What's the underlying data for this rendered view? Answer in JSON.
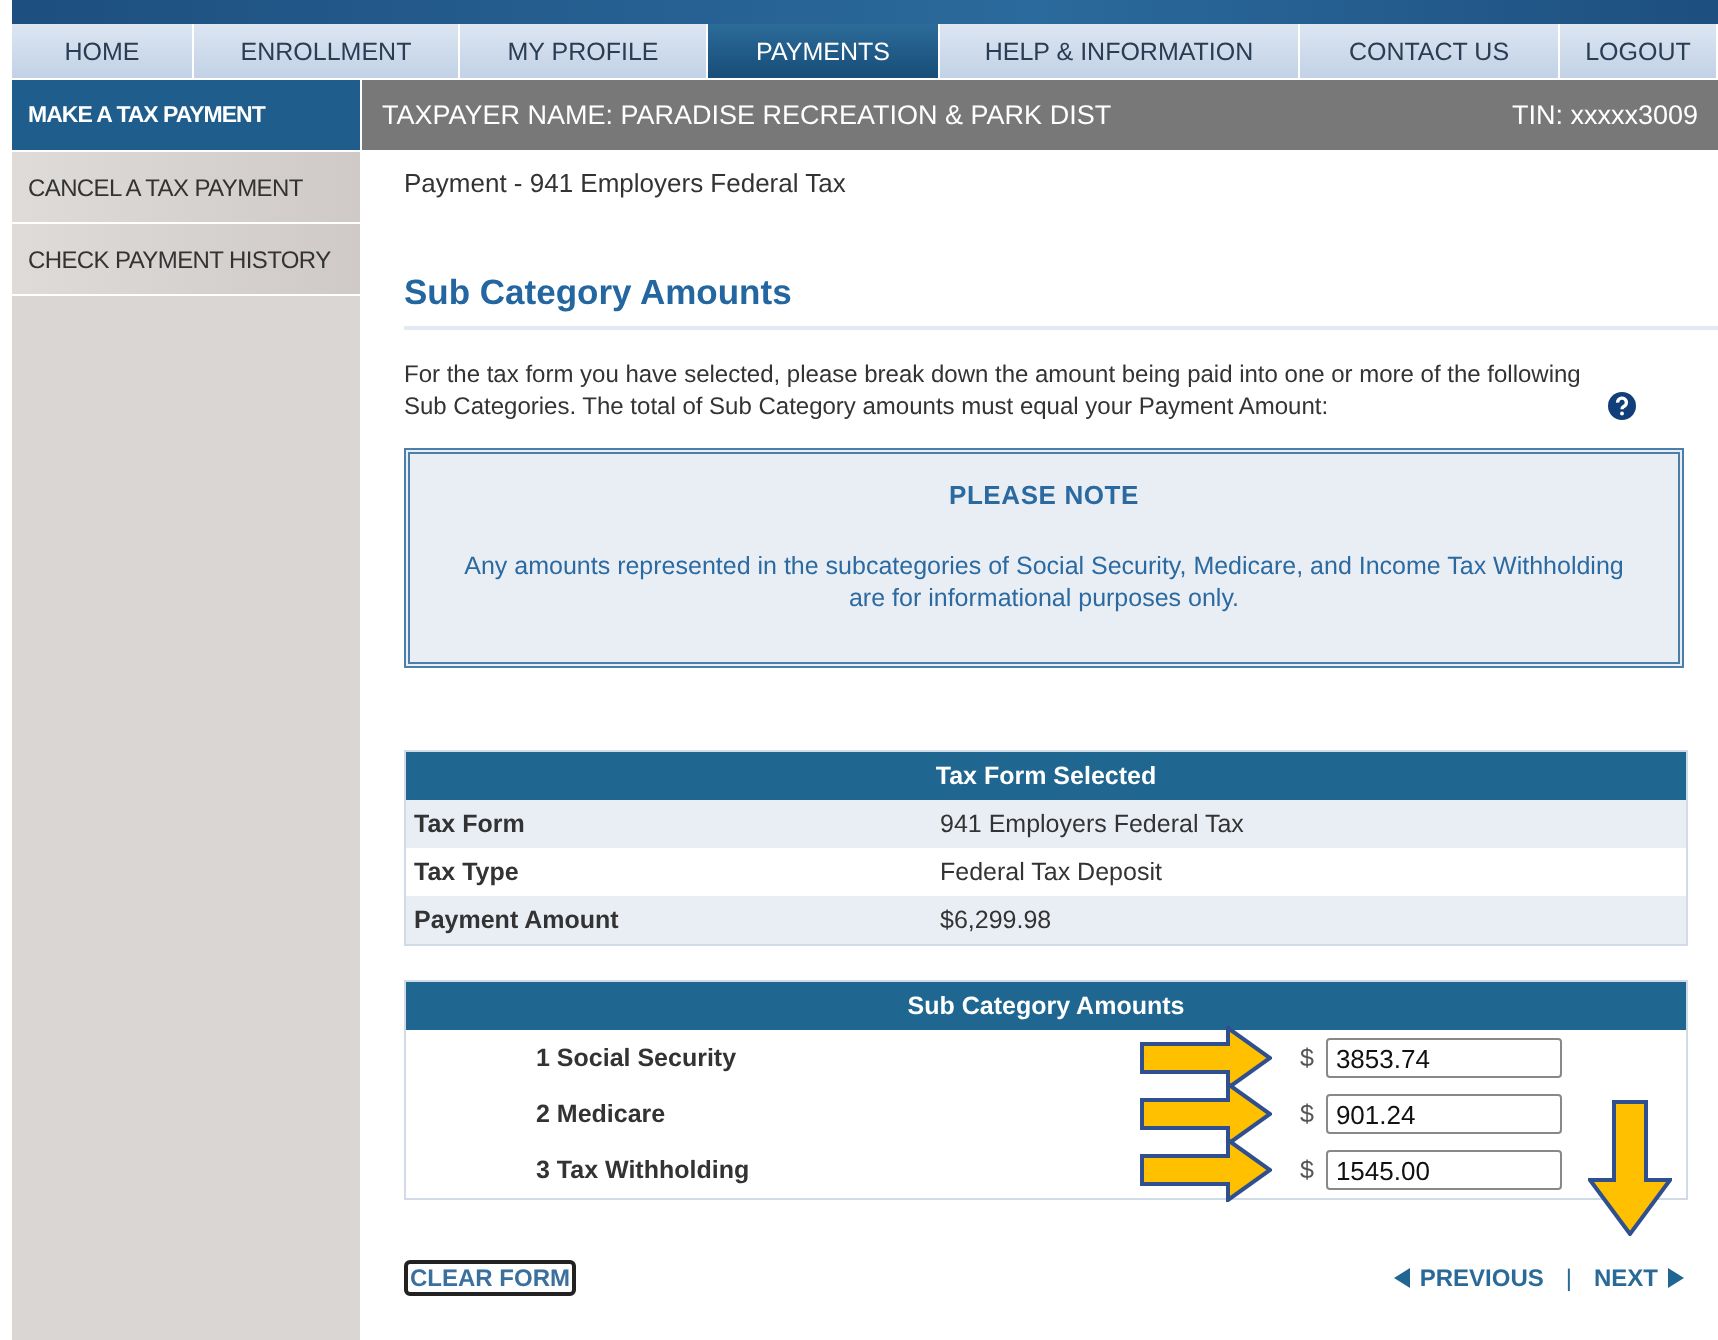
{
  "nav": [
    {
      "label": "HOME",
      "selected": false
    },
    {
      "label": "ENROLLMENT",
      "selected": false
    },
    {
      "label": "MY PROFILE",
      "selected": false
    },
    {
      "label": "PAYMENTS",
      "selected": true
    },
    {
      "label": "HELP & INFORMATION",
      "selected": false
    },
    {
      "label": "CONTACT US",
      "selected": false
    },
    {
      "label": "LOGOUT",
      "selected": false
    }
  ],
  "sidebar": {
    "items": [
      {
        "label": "MAKE A TAX PAYMENT",
        "selected": true
      },
      {
        "label": "CANCEL A TAX PAYMENT",
        "selected": false
      },
      {
        "label": "CHECK PAYMENT HISTORY",
        "selected": false
      }
    ]
  },
  "header": {
    "taxpayer": "TAXPAYER NAME: PARADISE RECREATION & PARK DIST",
    "tin": "TIN: xxxxx3009"
  },
  "breadcrumb": "Payment - 941 Employers Federal Tax",
  "heading": "Sub Category Amounts",
  "intro": "For the tax form you have selected, please break down the amount being paid into one or more of the following Sub Categories. The total of Sub Category amounts must equal your Payment Amount:",
  "note": {
    "title": "PLEASE NOTE",
    "text": "Any amounts represented in the subcategories of Social Security, Medicare, and Income Tax Withholding are for informational purposes only."
  },
  "tax_form_table": {
    "title": "Tax Form Selected",
    "rows": [
      {
        "label": "Tax Form",
        "value": "941 Employers Federal Tax"
      },
      {
        "label": "Tax Type",
        "value": "Federal Tax Deposit"
      },
      {
        "label": "Payment Amount",
        "value": "$6,299.98"
      }
    ]
  },
  "sub_table": {
    "title": "Sub Category Amounts",
    "rows": [
      {
        "label": "1 Social Security",
        "currency": "$",
        "value": "3853.74",
        "arrow": true
      },
      {
        "label": "2 Medicare",
        "currency": "$",
        "value": "901.24",
        "arrow": true
      },
      {
        "label": "3 Tax Withholding",
        "currency": "$",
        "value": "1545.00",
        "arrow": true
      }
    ]
  },
  "footer": {
    "clear": "CLEAR FORM",
    "previous": "PREVIOUS",
    "separator": "|",
    "next": "NEXT",
    "next_arrow": true
  }
}
